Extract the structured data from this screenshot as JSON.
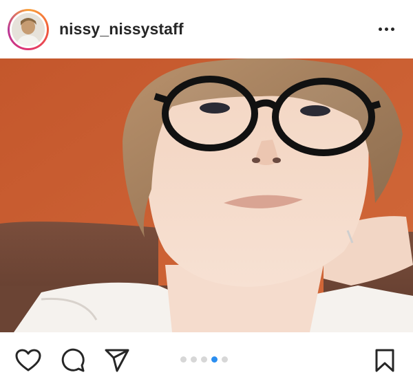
{
  "post": {
    "username": "nissy_nissystaff"
  },
  "icons": {
    "more": "more-horizontal-icon",
    "like": "heart-icon",
    "comment": "comment-icon",
    "share": "send-icon",
    "save": "bookmark-icon"
  },
  "carousel": {
    "total": 5,
    "active_index": 3
  },
  "colors": {
    "text": "#262626",
    "active_dot": "#2b8ef0",
    "inactive_dot": "#d7d7d7",
    "wall": "#c65a2e"
  }
}
